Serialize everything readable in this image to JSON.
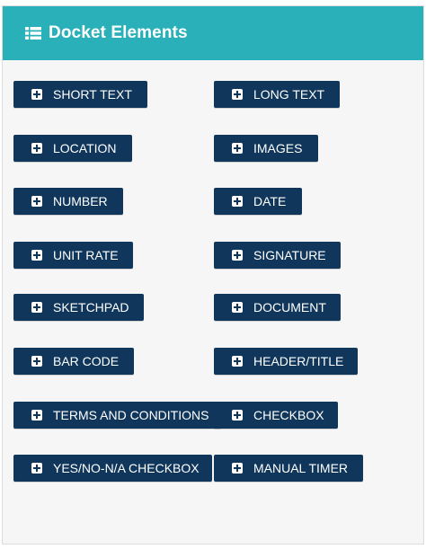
{
  "header": {
    "title": "Docket Elements",
    "icon": "list-icon",
    "color": "#2ab0b8"
  },
  "buttons": [
    {
      "label": "SHORT TEXT",
      "icon": "plus-square-icon"
    },
    {
      "label": "LONG TEXT",
      "icon": "plus-square-icon"
    },
    {
      "label": "LOCATION",
      "icon": "plus-square-icon"
    },
    {
      "label": "IMAGES",
      "icon": "plus-square-icon"
    },
    {
      "label": "NUMBER",
      "icon": "plus-square-icon"
    },
    {
      "label": "DATE",
      "icon": "plus-square-icon"
    },
    {
      "label": "UNIT RATE",
      "icon": "plus-square-icon"
    },
    {
      "label": "SIGNATURE",
      "icon": "plus-square-icon"
    },
    {
      "label": "SKETCHPAD",
      "icon": "plus-square-icon"
    },
    {
      "label": "DOCUMENT",
      "icon": "plus-square-icon"
    },
    {
      "label": "BAR CODE",
      "icon": "plus-square-icon"
    },
    {
      "label": "HEADER/TITLE",
      "icon": "plus-square-icon"
    },
    {
      "label": "TERMS AND CONDITIONS",
      "icon": "plus-square-icon"
    },
    {
      "label": "CHECKBOX",
      "icon": "plus-square-icon"
    },
    {
      "label": "YES/NO-N/A CHECKBOX",
      "icon": "plus-square-icon"
    },
    {
      "label": "MANUAL TIMER",
      "icon": "plus-square-icon"
    }
  ],
  "button_color": "#10375b"
}
